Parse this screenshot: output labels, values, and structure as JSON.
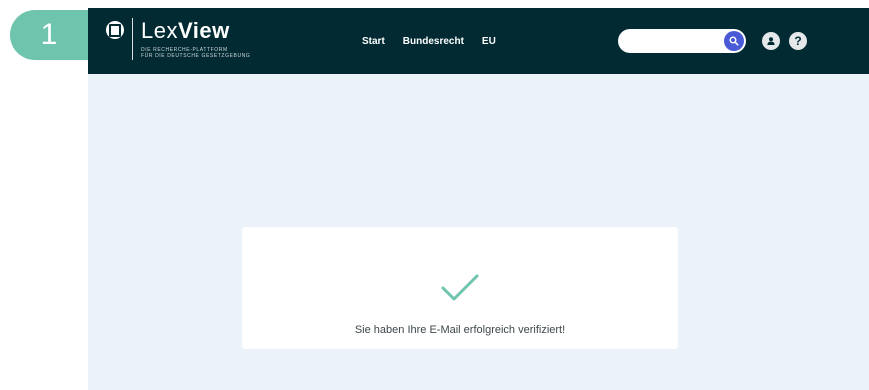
{
  "step": {
    "number": "1"
  },
  "brand": {
    "name_light": "Lex",
    "name_bold": "View",
    "tagline_line1": "DIE RECHERCHE-PLATTFORM",
    "tagline_line2": "FÜR DIE DEUTSCHE GESETZGEBUNG"
  },
  "nav": {
    "items": [
      {
        "label": "Start"
      },
      {
        "label": "Bundesrecht"
      },
      {
        "label": "EU"
      }
    ]
  },
  "search": {
    "value": "",
    "placeholder": ""
  },
  "icons": {
    "logo": "logo-mark-icon",
    "search": "search-icon",
    "user": "user-icon",
    "help": "help-icon",
    "check": "checkmark-icon"
  },
  "colors": {
    "header": "#012a32",
    "background": "#ecf2fa",
    "accent": "#4a59d6",
    "success": "#6fc4ad"
  },
  "confirmation": {
    "message": "Sie haben Ihre E-Mail erfolgreich verifiziert!"
  }
}
